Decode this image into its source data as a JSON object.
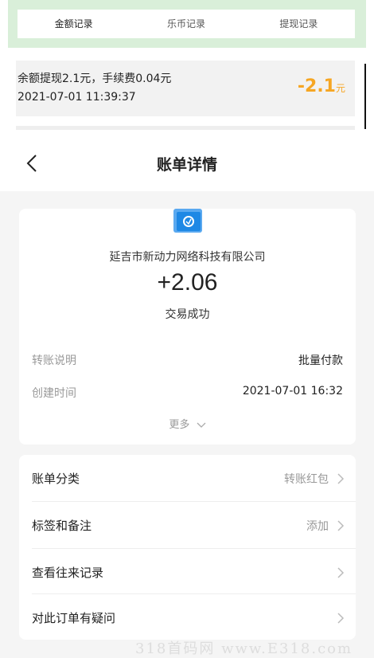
{
  "records_page": {
    "tabs": [
      {
        "label": "金额记录",
        "active": true
      },
      {
        "label": "乐币记录",
        "active": false
      },
      {
        "label": "提现记录",
        "active": false
      }
    ],
    "record": {
      "description": "余额提现2.1元，手续费0.04元",
      "time": "2021-07-01 11:39:37",
      "amount": "-2.1",
      "unit": "元"
    }
  },
  "bill_detail": {
    "title": "账单详情",
    "merchant": "延吉市新动力网络科技有限公司",
    "amount": "+2.06",
    "status": "交易成功",
    "rows": [
      {
        "key": "转账说明",
        "value": "批量付款"
      },
      {
        "key": "创建时间",
        "value": "2021-07-01 16:32"
      }
    ],
    "more_label": "更多"
  },
  "menu": [
    {
      "label": "账单分类",
      "value": "转账红包"
    },
    {
      "label": "标签和备注",
      "value": "添加"
    },
    {
      "label": "查看往来记录",
      "value": ""
    },
    {
      "label": "对此订单有疑问",
      "value": ""
    }
  ],
  "watermark": "318首码网 www.E318.com",
  "colors": {
    "accent_orange": "#f6a623",
    "tab_band_green": "#d9efd9",
    "logo_blue": "#1e88e5"
  }
}
